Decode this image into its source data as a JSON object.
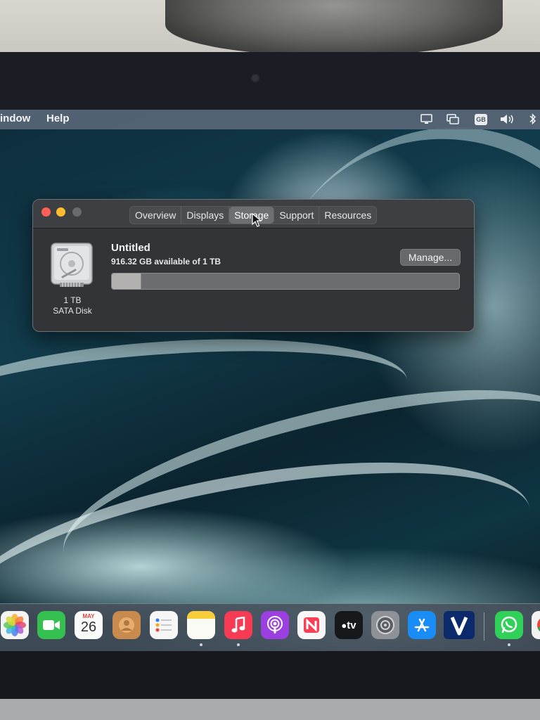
{
  "menubar": {
    "items": [
      "indow",
      "Help"
    ],
    "status_icons": [
      "display-icon",
      "screen-mirroring-icon",
      "input-source-gb",
      "volume-icon",
      "bluetooth-icon"
    ],
    "input_source": "GB"
  },
  "window": {
    "tabs": [
      {
        "label": "Overview",
        "active": false
      },
      {
        "label": "Displays",
        "active": false
      },
      {
        "label": "Storage",
        "active": true
      },
      {
        "label": "Support",
        "active": false
      },
      {
        "label": "Resources",
        "active": false
      }
    ],
    "disk": {
      "size_label": "1 TB",
      "type_label": "SATA Disk",
      "volume_name": "Untitled",
      "available_text": "916.32 GB available of 1 TB",
      "used_fraction": 0.084,
      "manage_label": "Manage..."
    }
  },
  "dock": {
    "calendar_month": "MAY",
    "calendar_day": "26",
    "appletv_label": "tv",
    "apps": [
      "photos-icon",
      "facetime-icon",
      "calendar-icon",
      "contacts-icon",
      "reminders-icon",
      "notes-icon",
      "music-icon",
      "podcasts-icon",
      "news-icon",
      "appletv-icon",
      "system-settings-icon",
      "app-store-icon",
      "v-app-icon",
      "whatsapp-icon",
      "chrome-icon"
    ]
  },
  "colors": {
    "close": "#fe5f57",
    "minimize": "#febc2e",
    "window_bg": "#323438"
  }
}
